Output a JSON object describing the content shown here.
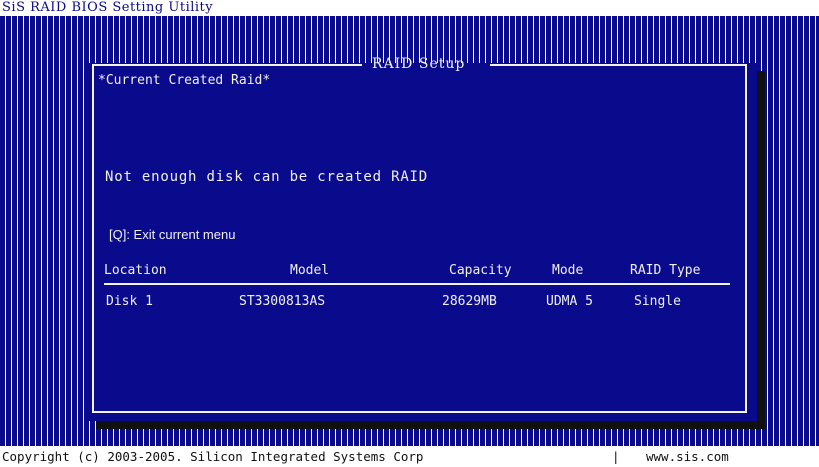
{
  "app_title": "SiS RAID BIOS Setting Utility",
  "dialog": {
    "title": "RAID Setup",
    "section_label": "*Current Created Raid*",
    "message": "Not enough disk can be created RAID",
    "exit_hint": "[Q]: Exit current menu"
  },
  "table": {
    "columns": [
      "Location",
      "Model",
      "Capacity",
      "Mode",
      "RAID Type"
    ],
    "rows": [
      [
        "Disk 1",
        "ST3300813AS",
        "28629MB",
        "UDMA 5",
        "Single"
      ]
    ]
  },
  "footer": {
    "copyright": "Copyright (c) 2003-2005. Silicon Integrated Systems Corp",
    "separator": "|",
    "website": "www.sis.com"
  },
  "colors": {
    "background_blue": "#0a0a8c",
    "text": "#f0f0f0",
    "stripe": "#ffffff"
  }
}
